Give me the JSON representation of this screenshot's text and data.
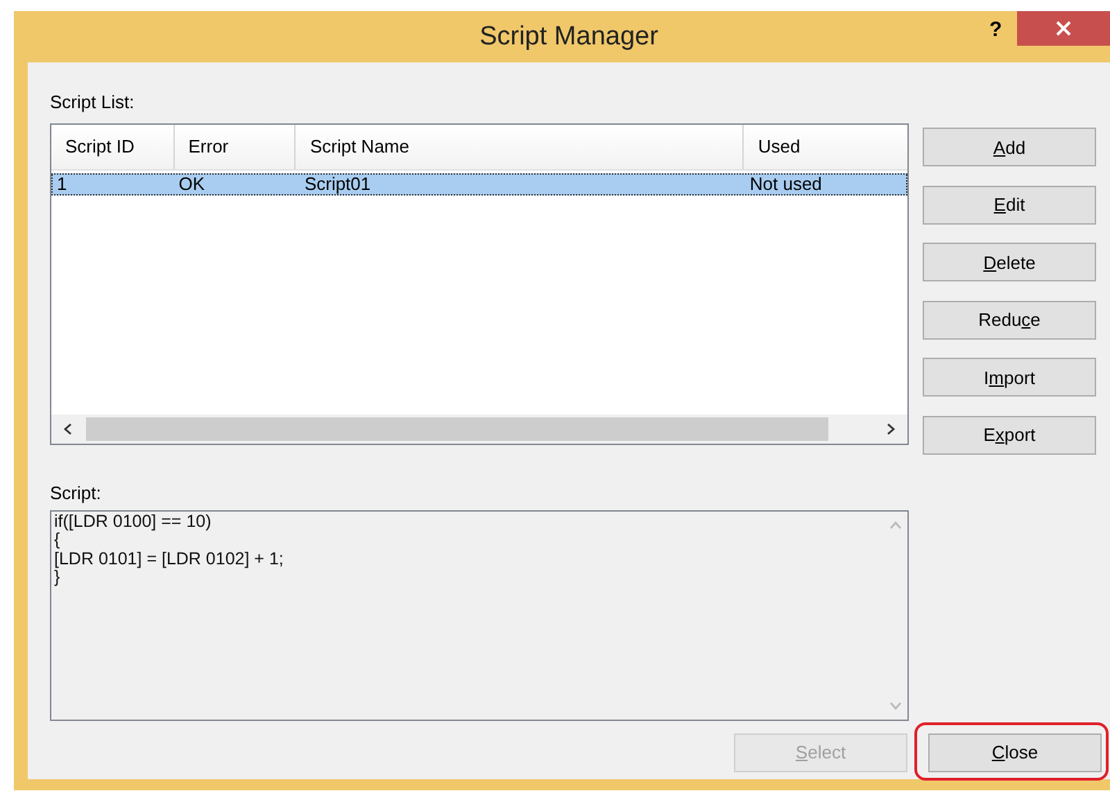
{
  "window": {
    "title": "Script Manager",
    "help": "?"
  },
  "script_list": {
    "label": "Script List:",
    "columns": [
      "Script ID",
      "Error",
      "Script Name",
      "Used"
    ],
    "rows": [
      {
        "cells": [
          "1",
          "OK",
          "Script01",
          "Not used"
        ],
        "selected": true
      }
    ]
  },
  "side_buttons": [
    {
      "label": "Add",
      "underlined": [
        true,
        false,
        false
      ],
      "disabled": false
    },
    {
      "label": "Edit",
      "underlined": [
        true,
        false,
        false,
        false
      ],
      "disabled": false
    },
    {
      "label": "Delete",
      "underlined": [
        true,
        false,
        false,
        false,
        false,
        false
      ],
      "disabled": false
    },
    {
      "label": "Reduce",
      "underlined": [
        false,
        false,
        false,
        false,
        true,
        false
      ],
      "disabled": false
    },
    {
      "label": "Import",
      "underlined": [
        false,
        true,
        false,
        false,
        false,
        false
      ],
      "disabled": false
    },
    {
      "label": "Export",
      "underlined": [
        false,
        true,
        false,
        false,
        false,
        false
      ],
      "disabled": false
    }
  ],
  "script": {
    "label": "Script:",
    "lines": [
      "if([LDR 0100] == 10)",
      "{",
      "[LDR 0101] = [LDR 0102] + 1;",
      "}"
    ]
  },
  "bottom_buttons": [
    {
      "label": "Select",
      "underlined": [
        true,
        false,
        false,
        false,
        false,
        false
      ],
      "disabled": true,
      "highlighted": false
    },
    {
      "label": "Close",
      "underlined": [
        true,
        false,
        false,
        false,
        false
      ],
      "disabled": false,
      "highlighted": true
    }
  ]
}
